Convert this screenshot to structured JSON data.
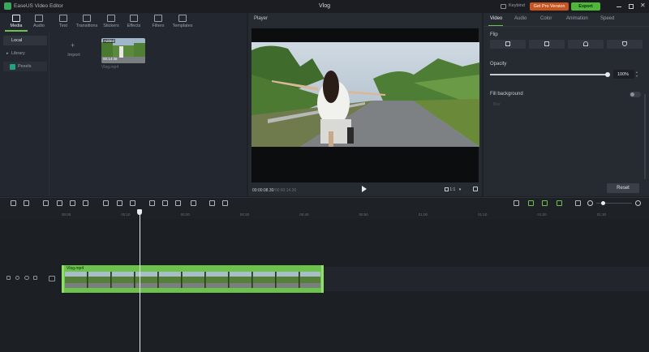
{
  "app": {
    "name": "EaseUS Video Editor",
    "document_title": "Vlog",
    "keybind_label": "Keybind",
    "pro_button": "Get Pro Version",
    "export_button": "Export"
  },
  "media_tabs": [
    {
      "label": "Media",
      "icon": "media-icon"
    },
    {
      "label": "Audio",
      "icon": "audio-icon"
    },
    {
      "label": "Text",
      "icon": "text-icon"
    },
    {
      "label": "Transitions",
      "icon": "transitions-icon"
    },
    {
      "label": "Stickers",
      "icon": "stickers-icon"
    },
    {
      "label": "Effects",
      "icon": "effects-icon"
    },
    {
      "label": "Filters",
      "icon": "filters-icon"
    },
    {
      "label": "Templates",
      "icon": "templates-icon"
    }
  ],
  "media_nav": {
    "local": "Local",
    "library": "Library",
    "pexels": "Pexels"
  },
  "media_items": {
    "import_label": "Import",
    "clip_badge": "Added",
    "clip_duration": "00:14:36",
    "clip_name": "Vlog.mp4"
  },
  "player": {
    "header": "Player",
    "current_time": "00:00:08.30",
    "total_time": "00:00:14.36",
    "ratio": "1:1"
  },
  "props_tabs": [
    "Video",
    "Audio",
    "Color",
    "Animation",
    "Speed"
  ],
  "props": {
    "flip_label": "Flip",
    "opacity_label": "Opacity",
    "opacity_value": "100%",
    "opacity_fraction": 1.0,
    "fill_background_label": "Fill background",
    "fill_background_option": "Blur",
    "reset_button": "Reset"
  },
  "timeline": {
    "ruler_ticks": [
      "00:00",
      "00:10",
      "00:20",
      "00:30",
      "00:40",
      "00:50",
      "01:00",
      "01:10",
      "01:20",
      "01:30"
    ],
    "clip_name": "Vlog.mp4"
  },
  "colors": {
    "accent_green": "#6cc24a",
    "export_green": "#4fb83a",
    "pro_orange": "#c5541f",
    "active_tab_text": "#e8ebef"
  }
}
